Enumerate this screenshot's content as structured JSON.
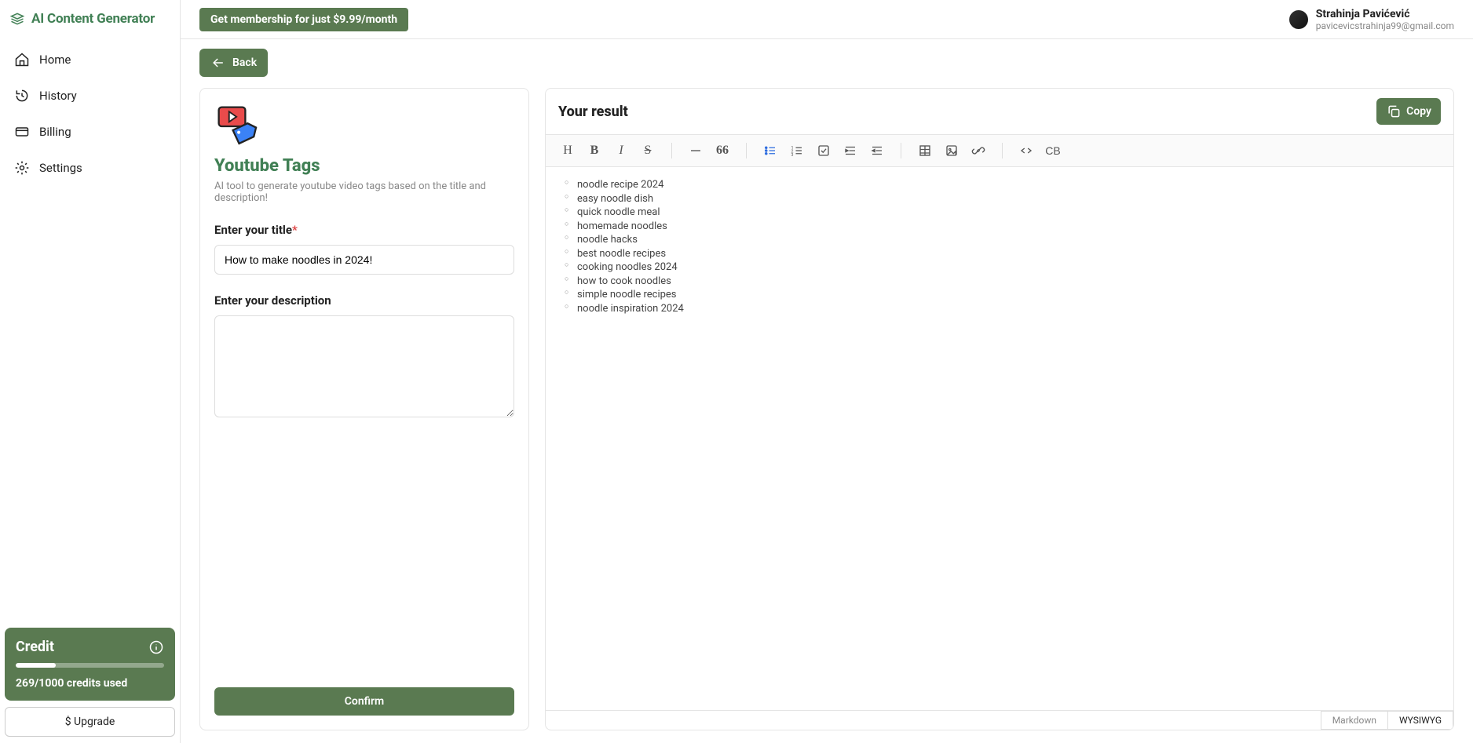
{
  "brand": {
    "name": "AI Content Generator"
  },
  "nav": {
    "home": "Home",
    "history": "History",
    "billing": "Billing",
    "settings": "Settings"
  },
  "credit": {
    "heading": "Credit",
    "used_text": "269/1000 credits used",
    "used": 269,
    "total": 1000,
    "upgrade_label": "$ Upgrade"
  },
  "topbar": {
    "membership": "Get membership for just $9.99/month"
  },
  "user": {
    "name": "Strahinja Pavićević",
    "email": "pavicevicstrahinja99@gmail.com"
  },
  "back_label": "Back",
  "tool": {
    "title": "Youtube Tags",
    "desc": "AI tool to generate youtube video tags based on the title and description!",
    "title_label": "Enter your title",
    "desc_label": "Enter your description",
    "title_value": "How to make noodles in 2024!",
    "desc_value": "",
    "confirm": "Confirm"
  },
  "result": {
    "heading": "Your result",
    "copy": "Copy",
    "items": [
      "noodle recipe 2024",
      "easy noodle dish",
      "quick noodle meal",
      "homemade noodles",
      "noodle hacks",
      "best noodle recipes",
      "cooking noodles 2024",
      "how to cook noodles",
      "simple noodle recipes",
      "noodle inspiration 2024"
    ],
    "mode_markdown": "Markdown",
    "mode_wysiwyg": "WYSIWYG"
  },
  "toolbar": {
    "heading": "H",
    "codeblock": "CB"
  }
}
